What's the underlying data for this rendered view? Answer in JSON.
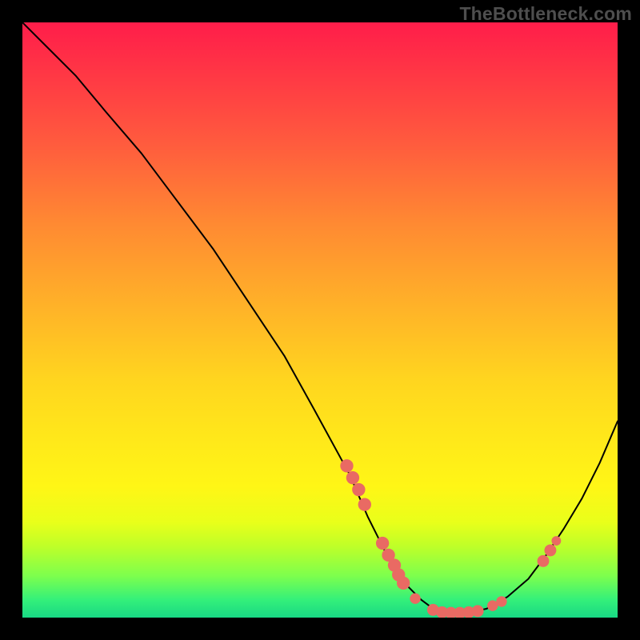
{
  "watermark": "TheBottleneck.com",
  "chart_data": {
    "type": "line",
    "title": "",
    "xlabel": "",
    "ylabel": "",
    "xlim": [
      0,
      100
    ],
    "ylim": [
      0,
      100
    ],
    "grid": false,
    "legend": false,
    "black_curve": {
      "x": [
        0,
        4,
        9,
        14,
        20,
        26,
        32,
        38,
        44,
        49,
        55,
        58,
        61,
        64,
        67,
        69,
        72,
        75,
        78,
        81.5,
        85,
        88,
        91,
        94,
        97,
        100
      ],
      "y": [
        100,
        96,
        91,
        85,
        78,
        70,
        62,
        53,
        44,
        35,
        24,
        17,
        11,
        6,
        3,
        1.5,
        0.8,
        0.8,
        1.5,
        3.5,
        6.5,
        10.5,
        15,
        20,
        26,
        33
      ]
    },
    "dot_series": {
      "name": "highlighted-points",
      "color": "#e96a63",
      "points": [
        {
          "x": 54.5,
          "y": 25.5,
          "r": 1.1
        },
        {
          "x": 55.5,
          "y": 23.5,
          "r": 1.1
        },
        {
          "x": 56.5,
          "y": 21.5,
          "r": 1.1
        },
        {
          "x": 57.5,
          "y": 19.0,
          "r": 1.1
        },
        {
          "x": 60.5,
          "y": 12.5,
          "r": 1.1
        },
        {
          "x": 61.5,
          "y": 10.5,
          "r": 1.1
        },
        {
          "x": 62.5,
          "y": 8.8,
          "r": 1.1
        },
        {
          "x": 63.2,
          "y": 7.2,
          "r": 1.1
        },
        {
          "x": 64.0,
          "y": 5.8,
          "r": 1.1
        },
        {
          "x": 66.0,
          "y": 3.2,
          "r": 0.9
        },
        {
          "x": 69.0,
          "y": 1.3,
          "r": 1.0
        },
        {
          "x": 70.5,
          "y": 0.9,
          "r": 1.0
        },
        {
          "x": 72.0,
          "y": 0.8,
          "r": 1.0
        },
        {
          "x": 73.5,
          "y": 0.8,
          "r": 1.0
        },
        {
          "x": 75.0,
          "y": 0.9,
          "r": 1.0
        },
        {
          "x": 76.5,
          "y": 1.1,
          "r": 1.0
        },
        {
          "x": 79.0,
          "y": 2.0,
          "r": 0.9
        },
        {
          "x": 80.5,
          "y": 2.7,
          "r": 0.9
        },
        {
          "x": 87.5,
          "y": 9.5,
          "r": 1.0
        },
        {
          "x": 88.7,
          "y": 11.3,
          "r": 1.0
        },
        {
          "x": 89.7,
          "y": 12.9,
          "r": 0.8
        }
      ]
    }
  }
}
